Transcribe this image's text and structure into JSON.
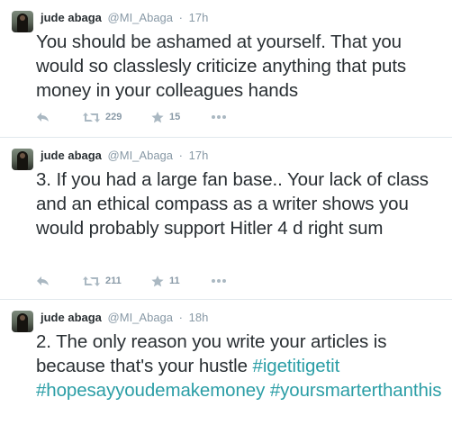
{
  "tweets": [
    {
      "author_name": "jude abaga",
      "handle": "@MI_Abaga",
      "separator": "·",
      "time": "17h",
      "text": "You should be ashamed at yourself. That you would so classlesly criticize anything that puts money in your colleagues hands",
      "retweets": "229",
      "favorites": "15"
    },
    {
      "author_name": "jude abaga",
      "handle": "@MI_Abaga",
      "separator": "·",
      "time": "17h",
      "text": "3. If you had a large fan base.. Your lack of class and an ethical compass as a writer shows you would probably support Hitler 4 d right sum",
      "retweets": "211",
      "favorites": "11"
    },
    {
      "author_name": "jude abaga",
      "handle": "@MI_Abaga",
      "separator": "·",
      "time": "18h",
      "text_plain": "2. The only reason you write your articles is because that's your hustle ",
      "hashtags": [
        "#igetitigetit",
        "#hopesayyoudemakemoney",
        "#yoursmarterthanthis"
      ]
    }
  ],
  "icons": {
    "reply": "reply-icon",
    "retweet": "retweet-icon",
    "favorite": "star-icon",
    "more": "more-icon"
  },
  "colors": {
    "text": "#292f33",
    "meta": "#8899a6",
    "action_icon": "#aab8c2",
    "hashtag": "#2b9ea6",
    "divider": "#e1e8ed"
  }
}
